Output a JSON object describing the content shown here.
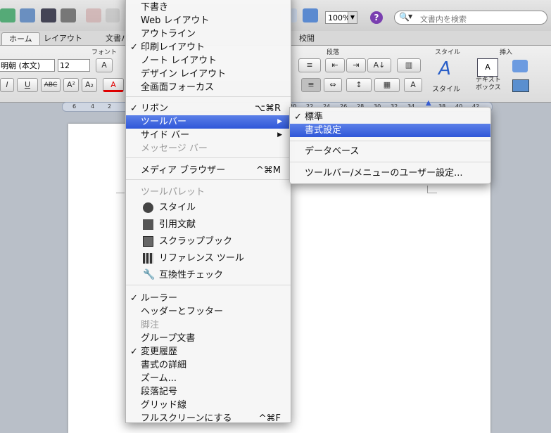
{
  "toolbar": {
    "zoom": "100%",
    "help": "?",
    "search_placeholder": "文書内を検索"
  },
  "ribbon": {
    "tabs": [
      "ホーム",
      "レイアウト",
      "文書パ",
      "校閲"
    ],
    "groups": {
      "font": "フォント",
      "paragraph": "段落",
      "style": "スタイル",
      "insert": "挿入"
    },
    "font_name": "明朝 (本文)",
    "font_size": "12",
    "style_button": "スタイル",
    "textbox_button": "テキスト\nボックス"
  },
  "ruler": {
    "ticks": [
      "6",
      "4",
      "2",
      "20",
      "22",
      "24",
      "26",
      "28",
      "30",
      "32",
      "34",
      "38",
      "40",
      "42"
    ]
  },
  "view_menu": {
    "items": [
      {
        "label": "下書き",
        "check": "",
        "shortcut": "",
        "state": "normal"
      },
      {
        "label": "Web レイアウト",
        "check": "",
        "shortcut": "",
        "state": "normal"
      },
      {
        "label": "アウトライン",
        "check": "",
        "shortcut": "",
        "state": "normal"
      },
      {
        "label": "印刷レイアウト",
        "check": "✓",
        "shortcut": "",
        "state": "normal"
      },
      {
        "label": "ノート レイアウト",
        "check": "",
        "shortcut": "",
        "state": "normal"
      },
      {
        "label": "デザイン レイアウト",
        "check": "",
        "shortcut": "",
        "state": "normal"
      },
      {
        "label": "全画面フォーカス",
        "check": "",
        "shortcut": "",
        "state": "normal"
      },
      {
        "label": "リボン",
        "check": "✓",
        "shortcut": "⌥⌘R",
        "state": "normal"
      },
      {
        "label": "ツールバー",
        "check": "",
        "shortcut": "",
        "state": "highlighted",
        "submenu": "▶"
      },
      {
        "label": "サイド バー",
        "check": "",
        "shortcut": "",
        "state": "normal",
        "submenu": "▶"
      },
      {
        "label": "メッセージ バー",
        "check": "",
        "shortcut": "",
        "state": "disabled"
      },
      {
        "label": "メディア ブラウザー",
        "check": "",
        "shortcut": "^⌘M",
        "state": "normal"
      },
      {
        "label": "ツールパレット",
        "check": "",
        "shortcut": "",
        "state": "disabled"
      },
      {
        "label": "スタイル",
        "icon": "style-palette-icon",
        "state": "normal"
      },
      {
        "label": "引用文献",
        "icon": "citations-icon",
        "state": "normal"
      },
      {
        "label": "スクラップブック",
        "icon": "scrapbook-icon",
        "state": "normal"
      },
      {
        "label": "リファレンス ツール",
        "icon": "reference-tools-icon",
        "state": "normal"
      },
      {
        "label": "互換性チェック",
        "icon": "wrench-icon",
        "state": "normal"
      },
      {
        "label": "ルーラー",
        "check": "✓",
        "shortcut": "",
        "state": "normal"
      },
      {
        "label": "ヘッダーとフッター",
        "check": "",
        "shortcut": "",
        "state": "normal"
      },
      {
        "label": "脚注",
        "check": "",
        "shortcut": "",
        "state": "disabled"
      },
      {
        "label": "グループ文書",
        "check": "",
        "shortcut": "",
        "state": "normal"
      },
      {
        "label": "変更履歴",
        "check": "✓",
        "shortcut": "",
        "state": "normal"
      },
      {
        "label": "書式の詳細",
        "check": "",
        "shortcut": "",
        "state": "normal"
      },
      {
        "label": "ズーム...",
        "check": "",
        "shortcut": "",
        "state": "normal"
      },
      {
        "label": "段落記号",
        "check": "",
        "shortcut": "",
        "state": "normal"
      },
      {
        "label": "グリッド線",
        "check": "",
        "shortcut": "",
        "state": "normal"
      },
      {
        "label": "フルスクリーンにする",
        "check": "",
        "shortcut": "^⌘F",
        "state": "normal"
      }
    ]
  },
  "toolbar_submenu": {
    "items": [
      {
        "label": "標準",
        "check": "✓",
        "state": "normal"
      },
      {
        "label": "書式設定",
        "check": "",
        "state": "highlighted"
      },
      {
        "label": "データベース",
        "check": "",
        "state": "normal"
      },
      {
        "label": "ツールバー/メニューのユーザー設定...",
        "check": "",
        "state": "normal"
      }
    ]
  },
  "colors": {
    "highlight": "#3a62dc",
    "help": "#7a3fb0",
    "font_color_bar": "#e00000"
  }
}
